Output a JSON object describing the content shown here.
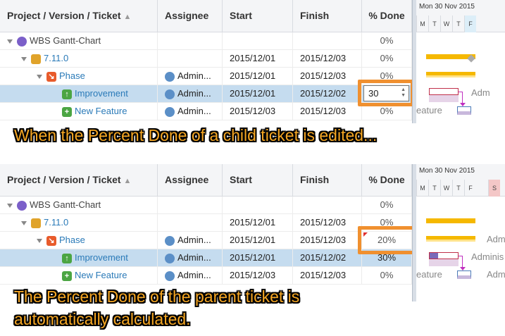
{
  "panel_top": {
    "columns": {
      "ticket": "Project / Version / Ticket",
      "sort_icon": "sort-up-icon",
      "assignee": "Assignee",
      "start": "Start",
      "finish": "Finish",
      "done": "% Done"
    },
    "gantt_month": "Mon 30 Nov 2015",
    "gantt_days": [
      "M",
      "T",
      "W",
      "T",
      "F"
    ],
    "rows": [
      {
        "ticket": "WBS Gantt-Chart",
        "assignee": "",
        "start": "",
        "finish": "",
        "done": "0%"
      },
      {
        "ticket": "7.11.0",
        "assignee": "",
        "start": "2015/12/01",
        "finish": "2015/12/03",
        "done": "0%"
      },
      {
        "ticket": "Phase",
        "assignee": "Admin...",
        "start": "2015/12/01",
        "finish": "2015/12/03",
        "done": "0%"
      },
      {
        "ticket": "Improvement",
        "assignee": "Admin...",
        "start": "2015/12/01",
        "finish": "2015/12/02",
        "done": "30"
      },
      {
        "ticket": "New Feature",
        "assignee": "Admin...",
        "start": "2015/12/03",
        "finish": "2015/12/03",
        "done": "0%"
      }
    ],
    "gantt_labels": {
      "improvement": "Adm",
      "new_feature": "eature"
    }
  },
  "caption_top": "When the Percent Done of a child ticket is edited...",
  "panel_bottom": {
    "columns": {
      "ticket": "Project / Version / Ticket",
      "sort_icon": "sort-up-icon",
      "assignee": "Assignee",
      "start": "Start",
      "finish": "Finish",
      "done": "% Done"
    },
    "gantt_month": "Mon 30 Nov 2015",
    "gantt_days": [
      "M",
      "T",
      "W",
      "T",
      "F",
      "S"
    ],
    "rows": [
      {
        "ticket": "WBS Gantt-Chart",
        "assignee": "",
        "start": "",
        "finish": "",
        "done": "0%"
      },
      {
        "ticket": "7.11.0",
        "assignee": "",
        "start": "2015/12/01",
        "finish": "2015/12/03",
        "done": "0%"
      },
      {
        "ticket": "Phase",
        "assignee": "Admin...",
        "start": "2015/12/01",
        "finish": "2015/12/03",
        "done": "20%"
      },
      {
        "ticket": "Improvement",
        "assignee": "Admin...",
        "start": "2015/12/01",
        "finish": "2015/12/02",
        "done": "30%"
      },
      {
        "ticket": "New Feature",
        "assignee": "Admin...",
        "start": "2015/12/03",
        "finish": "2015/12/03",
        "done": "0%"
      }
    ],
    "gantt_labels": {
      "phase": "Adm",
      "improvement": "Adminis",
      "new_feature": "eature",
      "new_feature_right": "Adm"
    }
  },
  "caption_bottom_1": "The Percent Done of the parent ticket is",
  "caption_bottom_2": "automatically calculated.",
  "colors": {
    "highlight": "#f0902f",
    "selected_row": "#c5dcef",
    "milestone_bar": "#f5b800",
    "caption_text": "#f5a623"
  }
}
